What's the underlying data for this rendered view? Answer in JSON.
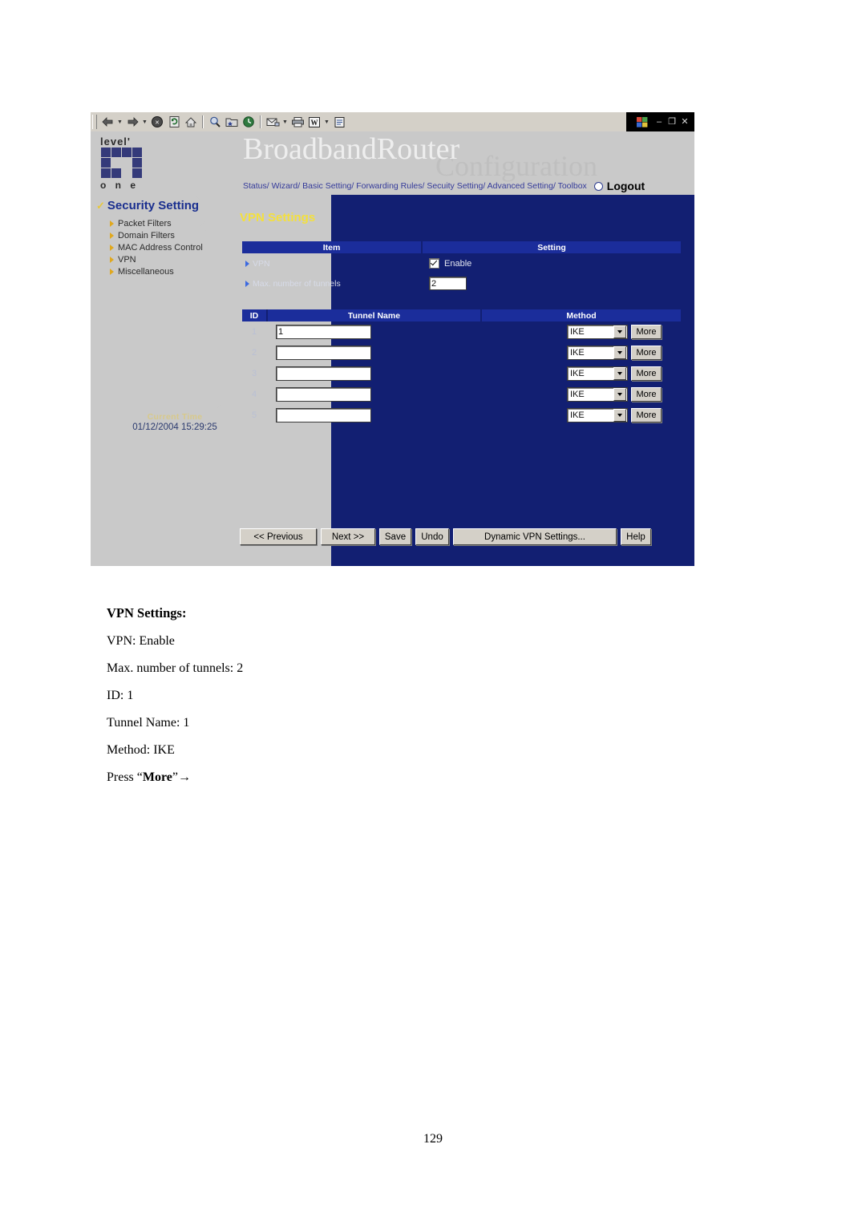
{
  "browser": {
    "toolbar_icons": [
      "back-icon",
      "back-dropdown-icon",
      "forward-icon",
      "forward-dropdown-icon",
      "stop-icon",
      "refresh-icon",
      "home-icon",
      "search-icon",
      "favorites-icon",
      "history-icon",
      "mail-icon",
      "mail-dropdown-icon",
      "print-icon",
      "edit-word-icon",
      "edit-dropdown-icon",
      "discuss-icon"
    ],
    "window_controls": {
      "minimize": "–",
      "restore": "❐",
      "close": "✕"
    }
  },
  "header": {
    "logo_top": "level'",
    "logo_bottom": "o n e",
    "product_title": "BroadbandRouter",
    "watermark": "Configuration",
    "nav": "Status/ Wizard/ Basic Setting/ Forwarding Rules/ Secuity Setting/ Advanced Setting/ Toolbox",
    "logout": "Logout"
  },
  "sidebar": {
    "section_title": "Security Setting",
    "items": [
      {
        "label": "Packet Filters"
      },
      {
        "label": "Domain Filters"
      },
      {
        "label": "MAC Address Control"
      },
      {
        "label": "VPN"
      },
      {
        "label": "Miscellaneous"
      }
    ],
    "current_time_label": "Current Time",
    "current_time_value": "01/12/2004 15:29:25"
  },
  "main": {
    "page_title": "VPN Settings",
    "settings_table": {
      "headers": [
        "Item",
        "Setting"
      ],
      "rows": [
        {
          "item": "VPN",
          "setting_type": "checkbox",
          "checkbox_label": "Enable",
          "checked": true
        },
        {
          "item": "Max. number of tunnels",
          "setting_type": "text",
          "value": "2"
        }
      ]
    },
    "tunnel_table": {
      "headers": [
        "ID",
        "Tunnel Name",
        "Method"
      ],
      "rows": [
        {
          "id": "1",
          "tunnel_name": "1",
          "method": "IKE",
          "more_label": "More"
        },
        {
          "id": "2",
          "tunnel_name": "",
          "method": "IKE",
          "more_label": "More"
        },
        {
          "id": "3",
          "tunnel_name": "",
          "method": "IKE",
          "more_label": "More"
        },
        {
          "id": "4",
          "tunnel_name": "",
          "method": "IKE",
          "more_label": "More"
        },
        {
          "id": "5",
          "tunnel_name": "",
          "method": "IKE",
          "more_label": "More"
        }
      ]
    },
    "buttons": {
      "previous": "<< Previous",
      "next": "Next >>",
      "save": "Save",
      "undo": "Undo",
      "dynamic": "Dynamic VPN Settings...",
      "help": "Help"
    }
  },
  "document": {
    "heading": "VPN Settings:",
    "lines": [
      "VPN: Enable",
      "Max. number of tunnels: 2",
      "ID: 1",
      "Tunnel Name: 1",
      "Method: IKE"
    ],
    "press_prefix": "Press “",
    "press_bold": "More",
    "press_suffix": "”→",
    "page_number": "129"
  },
  "colors": {
    "navy_panel": "#121f72",
    "header_blue": "#1b2d9b",
    "accent_yellow": "#f4e03c",
    "menu_triangle": "#e0a81e",
    "sidebar_grey": "#c9c9c9",
    "link_blue": "#343a9a"
  }
}
